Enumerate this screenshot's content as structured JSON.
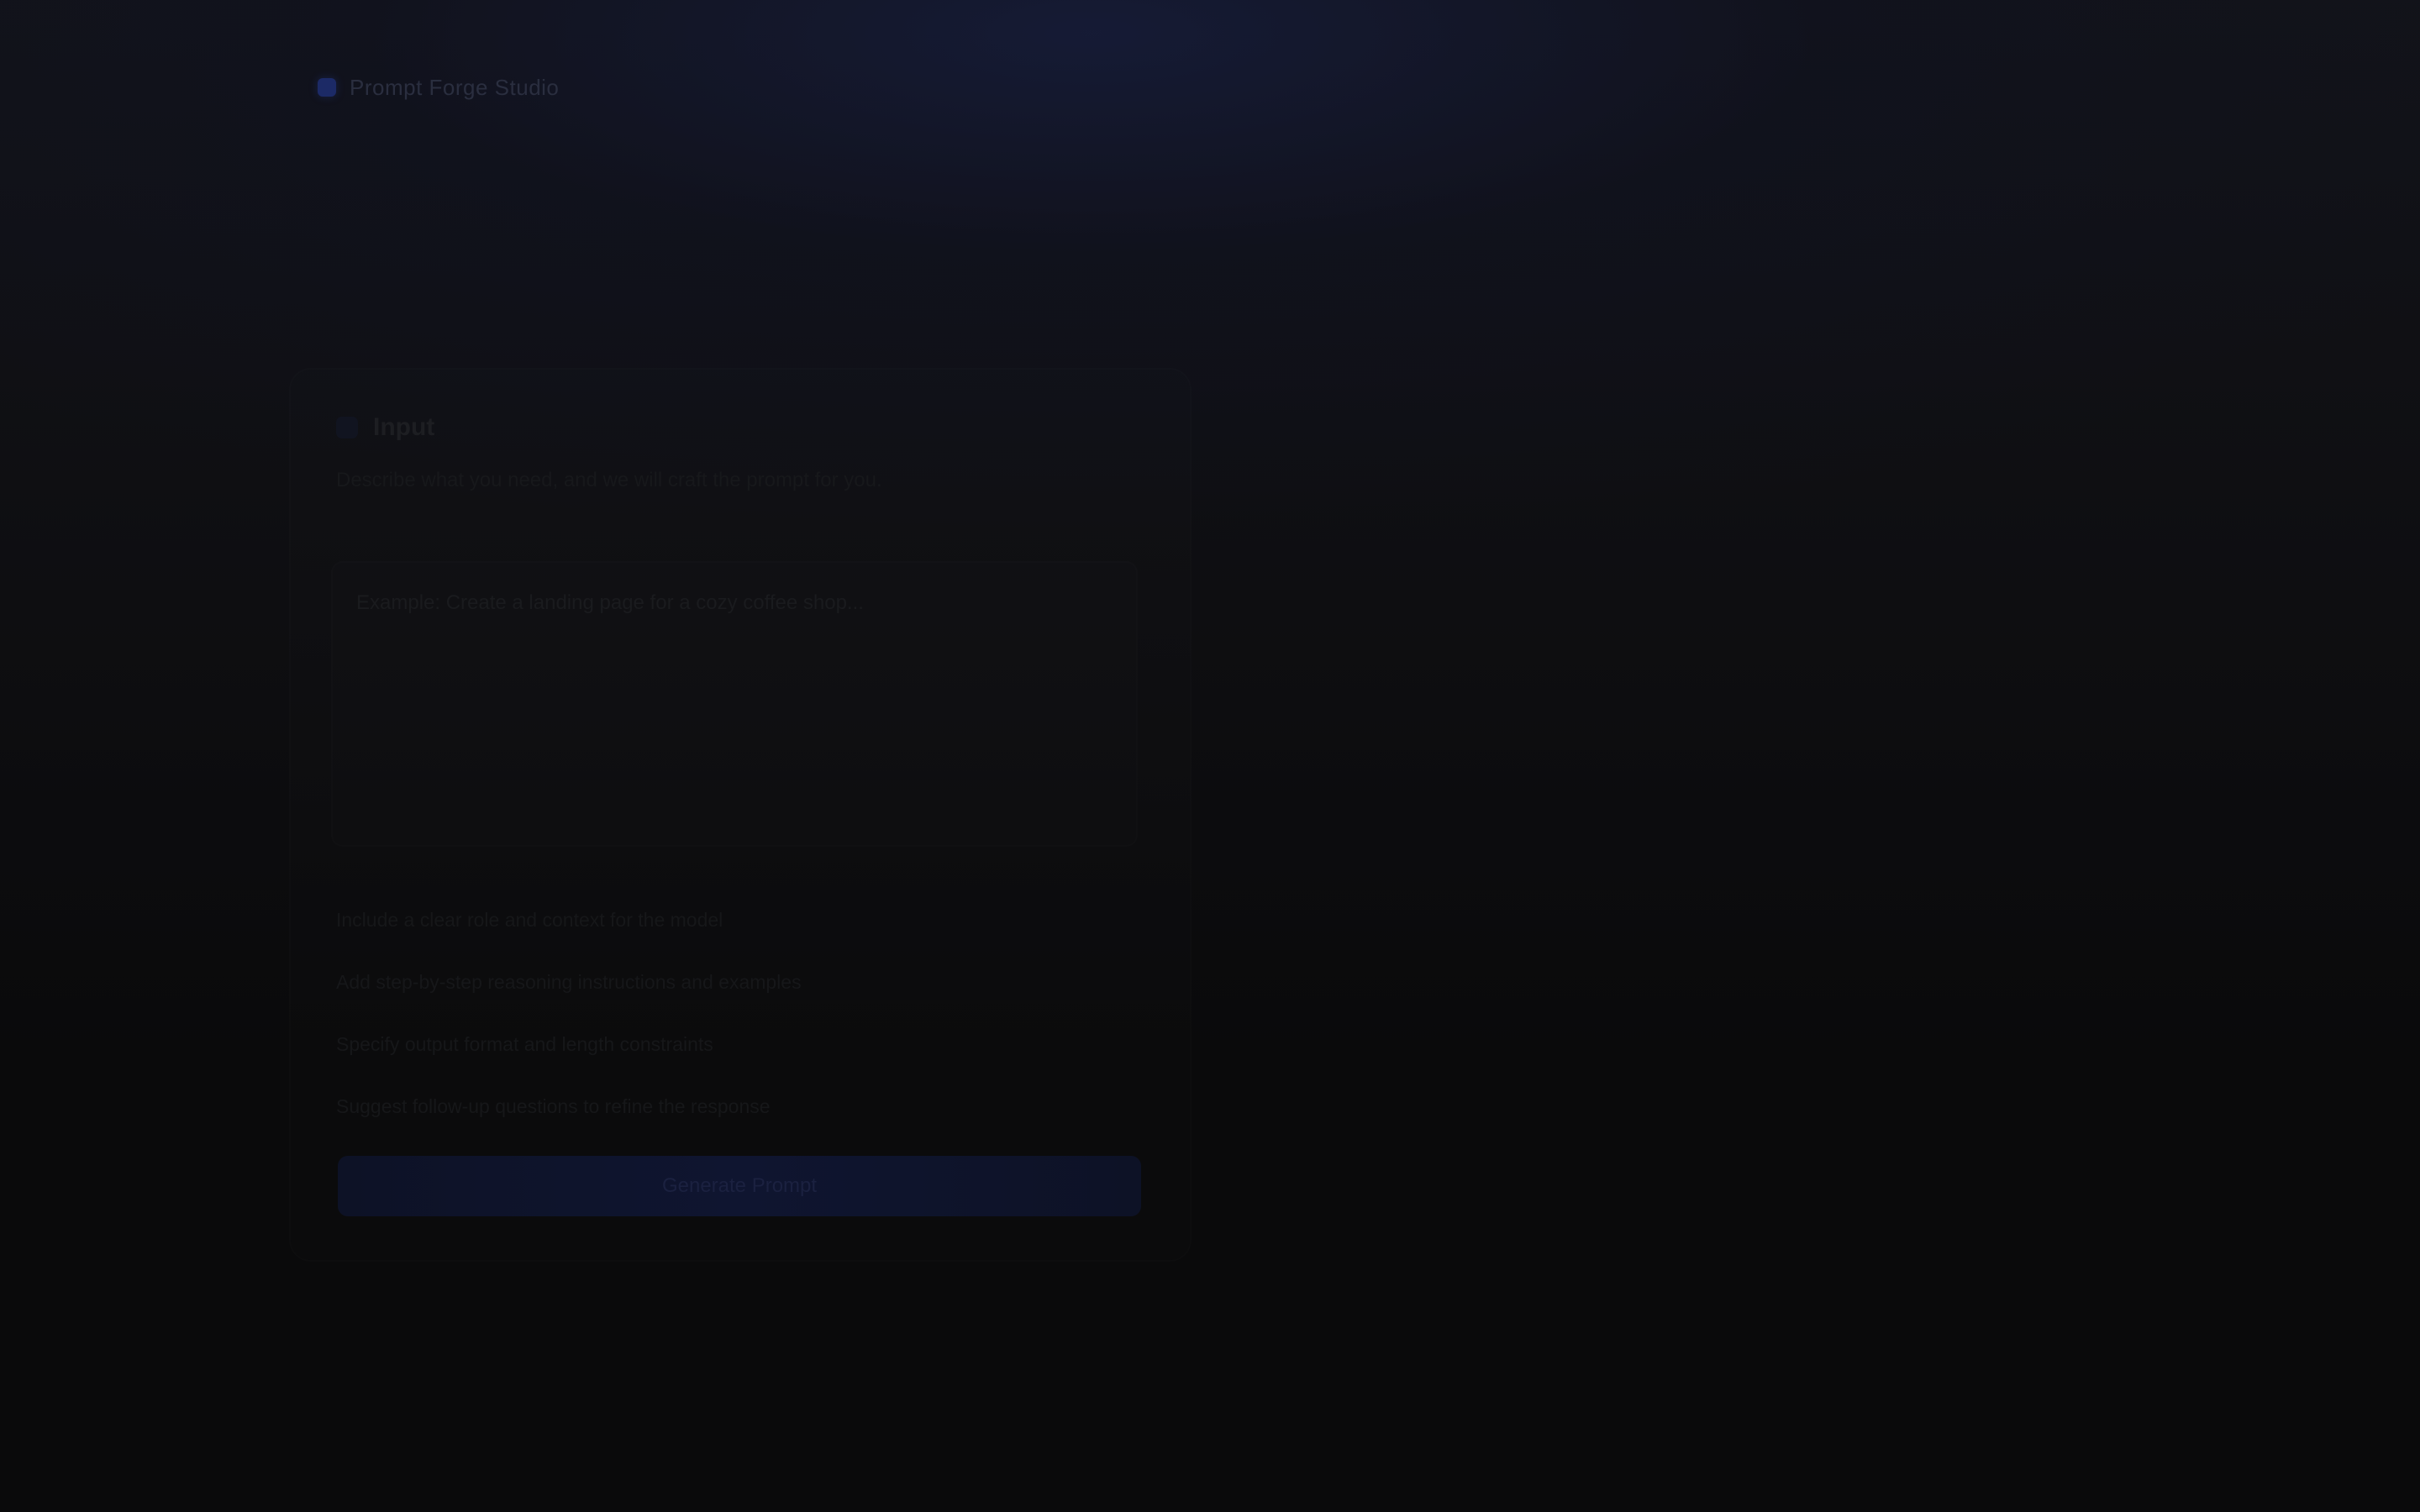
{
  "app": {
    "brand_name": "Prompt Forge Studio"
  },
  "card": {
    "title": "Input",
    "description": "Describe what you need, and we will craft the prompt for you.",
    "textarea": {
      "placeholder": "Example: Create a landing page for a cozy coffee shop...",
      "value": ""
    },
    "options": [
      {
        "label": "Include a clear role and context for the model"
      },
      {
        "label": "Add step-by-step reasoning instructions and examples"
      },
      {
        "label": "Specify output format and length constraints"
      },
      {
        "label": "Suggest follow-up questions to refine the response"
      }
    ],
    "submit_label": "Generate Prompt"
  }
}
